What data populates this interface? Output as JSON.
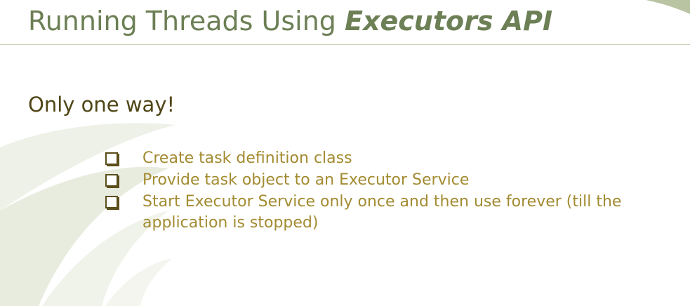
{
  "slide": {
    "title_plain": "Running Threads Using ",
    "title_emphasis": "Executors API",
    "subtitle": "Only one way!",
    "bullets": [
      "Create task definition class",
      "Provide task object to an Executor Service",
      "Start Executor Service only once and then use forever (till the application is stopped)"
    ],
    "bullet_icon": "checkbox-square-icon"
  },
  "colors": {
    "title": "#6c7f55",
    "subtitle": "#4f4516",
    "bullet_text": "#a38b31",
    "bullet_box": "#5b4e1a",
    "swoosh": "#e3e8d8"
  }
}
